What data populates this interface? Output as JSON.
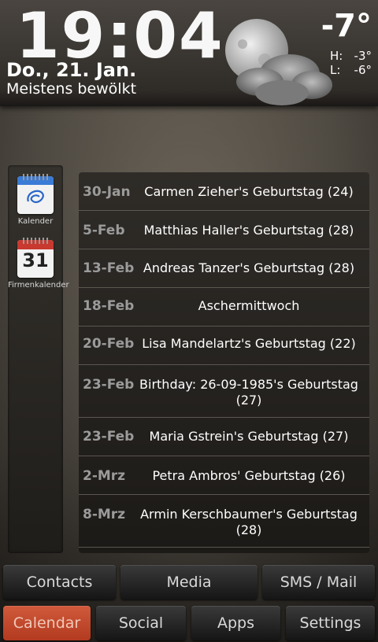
{
  "weather": {
    "time": "19:04",
    "date": "Do., 21. Jan.",
    "condition": "Meistens bewölkt",
    "temperature": "-7°",
    "high_label": "H:",
    "high": "-3°",
    "low_label": "L:",
    "low": "-6°",
    "icon": "cloudy-moon-icon"
  },
  "shortcuts": [
    {
      "label": "Kalender",
      "icon": "calendar-blue-icon"
    },
    {
      "label": "Firmenkalender",
      "icon": "calendar-31-icon",
      "day": "31"
    }
  ],
  "events": [
    {
      "date": "30-Jan",
      "title": "Carmen Zieher's Geburtstag (24)"
    },
    {
      "date": "5-Feb",
      "title": "Matthias Haller's Geburtstag (28)"
    },
    {
      "date": "13-Feb",
      "title": "Andreas Tanzer's Geburtstag (28)"
    },
    {
      "date": "18-Feb",
      "title": "Aschermittwoch"
    },
    {
      "date": "20-Feb",
      "title": "Lisa Mandelartz's Geburtstag (22)"
    },
    {
      "date": "23-Feb",
      "title": "Birthday: 26-09-1985's Geburtstag (27)"
    },
    {
      "date": "23-Feb",
      "title": "Maria Gstrein's Geburtstag (27)"
    },
    {
      "date": "2-Mrz",
      "title": "Petra Ambros' Geburtstag (26)"
    },
    {
      "date": "8-Mrz",
      "title": "Armin Kerschbaumer's Geburtstag (28)"
    }
  ],
  "nav_row1": [
    "Contacts",
    "Media",
    "SMS / Mail"
  ],
  "nav_row2": [
    "Calendar",
    "Social",
    "Apps",
    "Settings"
  ],
  "active_tab": "Calendar",
  "colors": {
    "active": "#c4482b",
    "event_date": "#9b9b9b"
  }
}
